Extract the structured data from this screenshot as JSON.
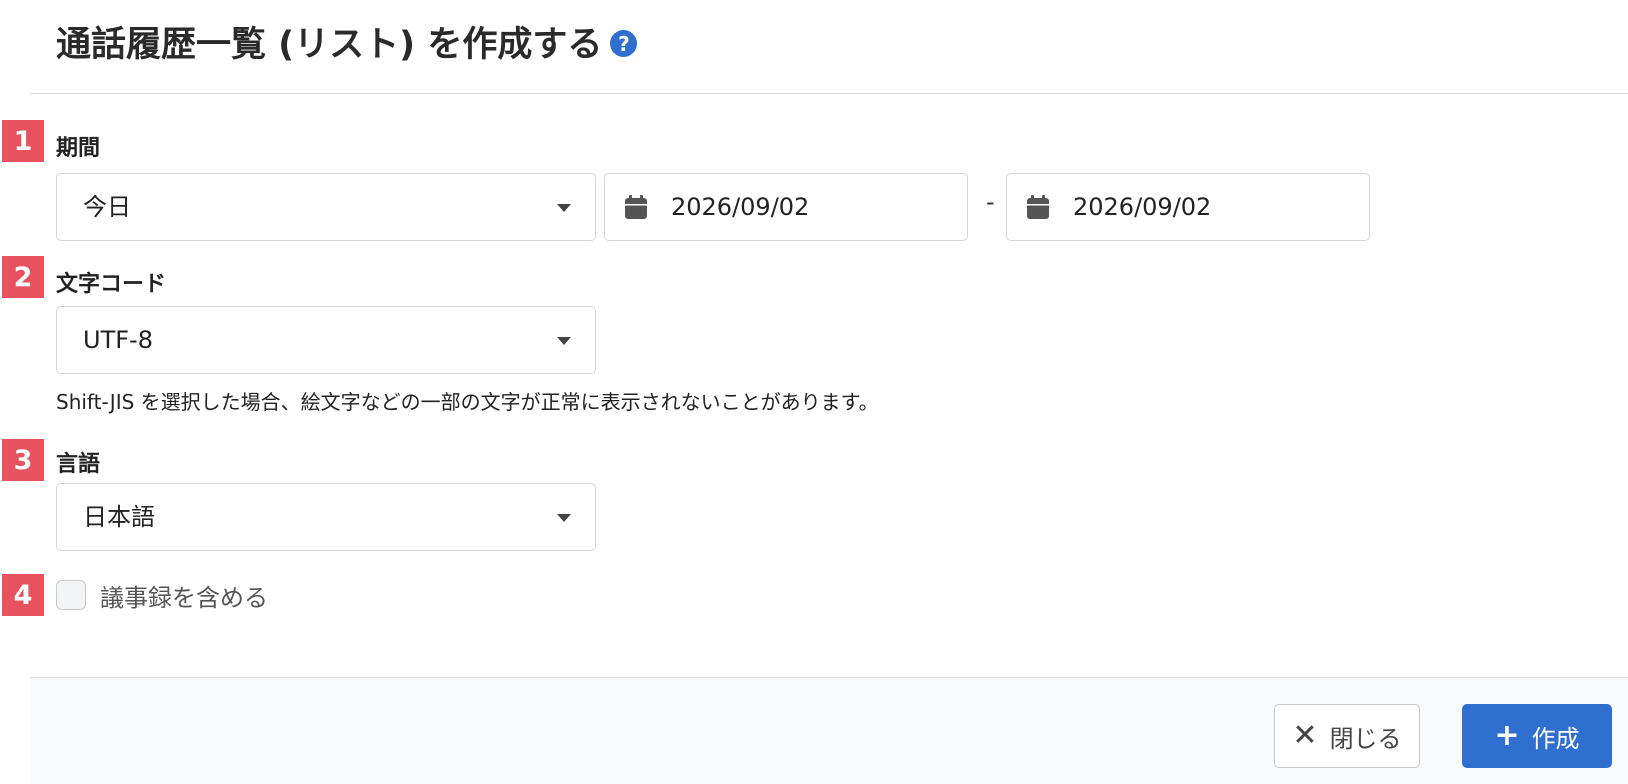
{
  "header": {
    "title": "通話履歴一覧 (リスト) を作成する",
    "help_icon": "?"
  },
  "sections": {
    "period": {
      "number": "1",
      "label": "期間",
      "select_value": "今日",
      "start_date": "2026/09/02",
      "separator": "-",
      "end_date": "2026/09/02"
    },
    "encoding": {
      "number": "2",
      "label": "文字コード",
      "select_value": "UTF-8",
      "note": "Shift-JIS を選択した場合、絵文字などの一部の文字が正常に表示されないことがあります。"
    },
    "language": {
      "number": "3",
      "label": "言語",
      "select_value": "日本語"
    },
    "minutes": {
      "number": "4",
      "label": "議事録を含める",
      "checked": false
    }
  },
  "footer": {
    "close_icon": "✕",
    "close_label": "閉じる",
    "create_icon": "+",
    "create_label": "作成"
  },
  "colors": {
    "badge": "#e8525f",
    "primary": "#2f6fcf",
    "border": "#d6d6d6",
    "footer_bg": "#f8f9fa"
  },
  "icons": {
    "help": "question-circle-icon",
    "calendar": "calendar-icon",
    "dropdown": "caret-down-icon",
    "close": "x-icon",
    "create": "plus-icon"
  }
}
